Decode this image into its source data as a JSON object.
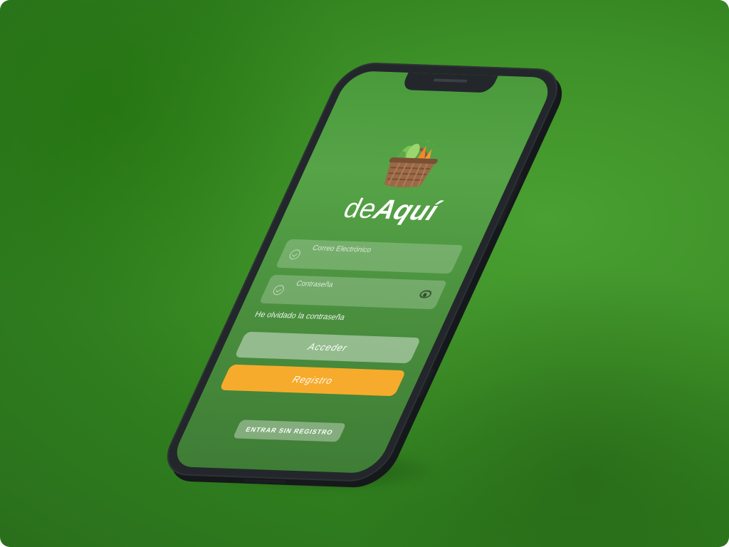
{
  "app": {
    "brand_light": "de",
    "brand_bold": "Aquí"
  },
  "login": {
    "email_placeholder": "Correo Electrónico",
    "password_placeholder": "Contraseña",
    "forgot_label": "He olvidado la contraseña",
    "access_label": "Acceder",
    "register_label": "Registro",
    "guest_label": "ENTRAR SIN REGISTRO"
  },
  "colors": {
    "background": "#3e9128",
    "screen": "#4e9a40",
    "register_button": "#f7ab2c",
    "phone_frame": "#23272b"
  },
  "icons": {
    "logo": "vegetable-basket-icon",
    "field_check": "check-circle-icon",
    "password_toggle": "eye-icon"
  }
}
